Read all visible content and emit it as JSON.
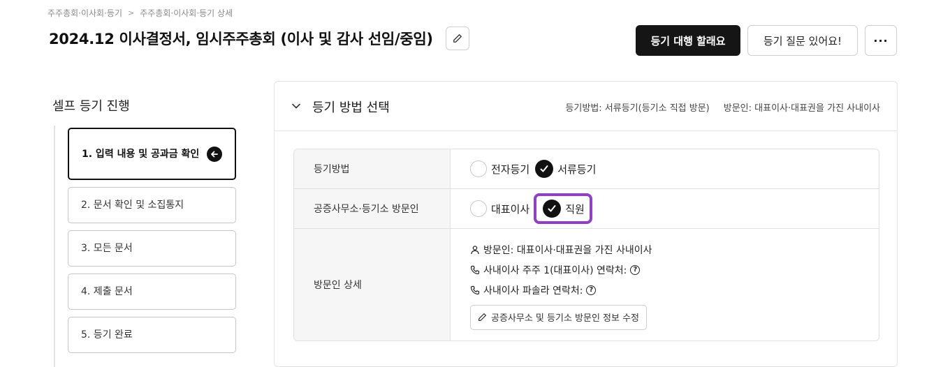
{
  "breadcrumb": {
    "items": [
      "주주총회·이사회·등기",
      "주주총회·이사회·등기 상세"
    ],
    "separator": ">"
  },
  "header": {
    "title": "2024.12 이사결정서, 임시주주총회 (이사 및 감사 선임/중임)",
    "primary_button": "등기 대행 할래요",
    "secondary_button": "등기 질문 있어요!",
    "more_label": "···"
  },
  "sidebar": {
    "title": "셀프 등기 진행",
    "steps": [
      {
        "label": "1. 입력 내용 및 공과금 확인",
        "active": true
      },
      {
        "label": "2. 문서 확인 및 소집통지",
        "active": false
      },
      {
        "label": "3. 모든 문서",
        "active": false
      },
      {
        "label": "4. 제출 문서",
        "active": false
      },
      {
        "label": "5. 등기 완료",
        "active": false
      }
    ]
  },
  "panel": {
    "title": "등기 방법 선택",
    "summary_method": "등기방법: 서류등기(등기소 직접 방문)",
    "summary_visitor": "방문인: 대표이사·대표권을 가진 사내이사",
    "rows": {
      "method": {
        "label": "등기방법",
        "options": [
          {
            "label": "전자등기",
            "checked": false
          },
          {
            "label": "서류등기",
            "checked": true
          }
        ]
      },
      "visitor": {
        "label": "공증사무소·등기소 방문인",
        "options": [
          {
            "label": "대표이사",
            "checked": false
          },
          {
            "label": "직원",
            "checked": true
          }
        ]
      },
      "detail": {
        "label": "방문인 상세",
        "visitor_line": "방문인: 대표이사·대표권을 가진 사내이사",
        "contact1": "사내이사 주주 1(대표이사) 연락처:",
        "contact2": "사내이사 파솔라 연락처:",
        "help_glyph": "?",
        "edit_button": "공증사무소 및 등기소 방문인 정보 수정"
      }
    }
  },
  "colors": {
    "highlight": "#8f3fc9",
    "primary": "#151515"
  }
}
